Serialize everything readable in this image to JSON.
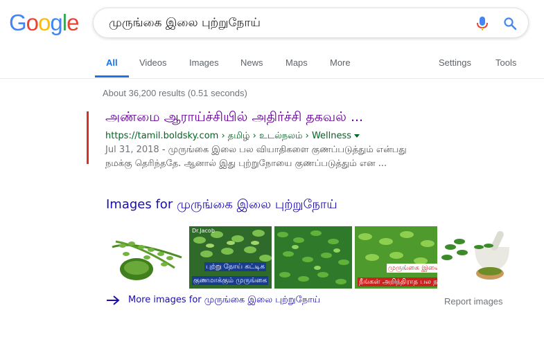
{
  "logo": {
    "letters": [
      "G",
      "o",
      "o",
      "g",
      "l",
      "e"
    ],
    "colors": [
      "#4285f4",
      "#ea4335",
      "#fbbc05",
      "#4285f4",
      "#34a853",
      "#ea4335"
    ]
  },
  "search": {
    "query": "முருங்கை இலை புற்றுநோய்",
    "mic_icon": "mic-icon",
    "search_icon": "search-icon"
  },
  "tabs": {
    "items": [
      {
        "label": "All",
        "active": true
      },
      {
        "label": "Videos"
      },
      {
        "label": "Images"
      },
      {
        "label": "News"
      },
      {
        "label": "Maps"
      },
      {
        "label": "More"
      },
      {
        "label": "Settings"
      },
      {
        "label": "Tools"
      }
    ]
  },
  "stats": "About 36,200 results (0.51 seconds)",
  "result": {
    "title": "அண்மை ஆராய்ச்சியில் அதிர்ச்சி தகவல் ...",
    "url": "https://tamil.boldsky.com › தமிழ் › உடல்நலம் › Wellness",
    "date": "Jul 31, 2018",
    "snippet_line1": " - முருங்கை இலை பல வியாதிகளை குணப்படுத்தும் என்பது",
    "snippet_line2": "நமக்கு தெரிந்ததே. ஆனால் இது புற்றுநோயை குணப்படுத்தும் என ..."
  },
  "images": {
    "heading": "Images for முருங்கை இலை புற்றுநோய்",
    "thumbs": [
      {
        "caption1": "",
        "caption2": ""
      },
      {
        "caption1": "புற்று நோய் கட்டிக",
        "caption2": "குணமாக்கும் முருங்கை",
        "watermark": "Dr.Jacob"
      },
      {
        "caption1": "",
        "caption2": ""
      },
      {
        "caption1": "முருங்கை இலை பு",
        "caption2": "நீங்கள் அறிந்திராத பல ந"
      },
      {
        "caption1": "",
        "caption2": ""
      }
    ],
    "more_link": "More images for முருங்கை இலை புற்றுநோய்",
    "report": "Report images"
  },
  "colors": {
    "accent": "#1a73e8",
    "visited_link": "#660099",
    "link": "#1a0dab",
    "url_green": "#006621",
    "result_bar": "#d93025"
  }
}
